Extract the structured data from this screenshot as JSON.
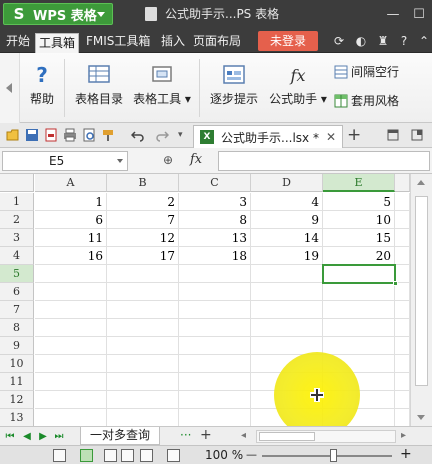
{
  "app": {
    "brand": "WPS 表格",
    "document_title": "公式助手示...PS 表格"
  },
  "colors": {
    "brand_green": "#3d9a3a",
    "login_red": "#e5604c",
    "selection_green": "#3a9a3a",
    "titlebar_dark": "#3c3c3c",
    "cursor_highlight": "#fff200"
  },
  "menu": {
    "items": [
      "开始",
      "工具箱",
      "FMIS工具箱",
      "插入",
      "页面布局"
    ],
    "active_index": 1,
    "login_label": "未登录",
    "right_icons": [
      "refresh-icon",
      "skin-icon",
      "shirt-icon",
      "help-icon",
      "collapse-icon"
    ]
  },
  "ribbon": {
    "help_label": "帮助",
    "table_toc_label": "表格目录",
    "table_tools_label": "表格工具",
    "step_hint_label": "逐步提示",
    "formula_helper_label": "公式助手",
    "interval_fill_label": "间隔空行",
    "apply_style_label": "套用风格"
  },
  "tabbar": {
    "doc_tab_label": "公式助手示...lsx *",
    "xls_icon_letter": "X",
    "quick_icons": [
      "open-icon",
      "save-icon",
      "pdf-icon",
      "print-icon",
      "preview-icon",
      "undo-icon",
      "redo-icon",
      "more-icon"
    ],
    "close_glyph": "✕",
    "add_glyph": "+"
  },
  "formula_bar": {
    "name_box": "E5",
    "fx_label": "fx",
    "formula_value": ""
  },
  "grid": {
    "columns": [
      "A",
      "B",
      "C",
      "D",
      "E"
    ],
    "rows": [
      "1",
      "2",
      "3",
      "4",
      "5",
      "6",
      "7",
      "8",
      "9",
      "10",
      "11",
      "12",
      "13"
    ],
    "selected_column": "E",
    "selected_row": "5",
    "cells": [
      [
        "1",
        "2",
        "3",
        "4",
        "5"
      ],
      [
        "6",
        "7",
        "8",
        "9",
        "10"
      ],
      [
        "11",
        "12",
        "13",
        "14",
        "15"
      ],
      [
        "16",
        "17",
        "18",
        "19",
        "20"
      ]
    ]
  },
  "sheets": {
    "tabs": [
      "一对多查询"
    ],
    "more_glyph": "···",
    "add_glyph": "+"
  },
  "status": {
    "zoom": "100 %",
    "minus_glyph": "—",
    "plus_glyph": "+"
  }
}
